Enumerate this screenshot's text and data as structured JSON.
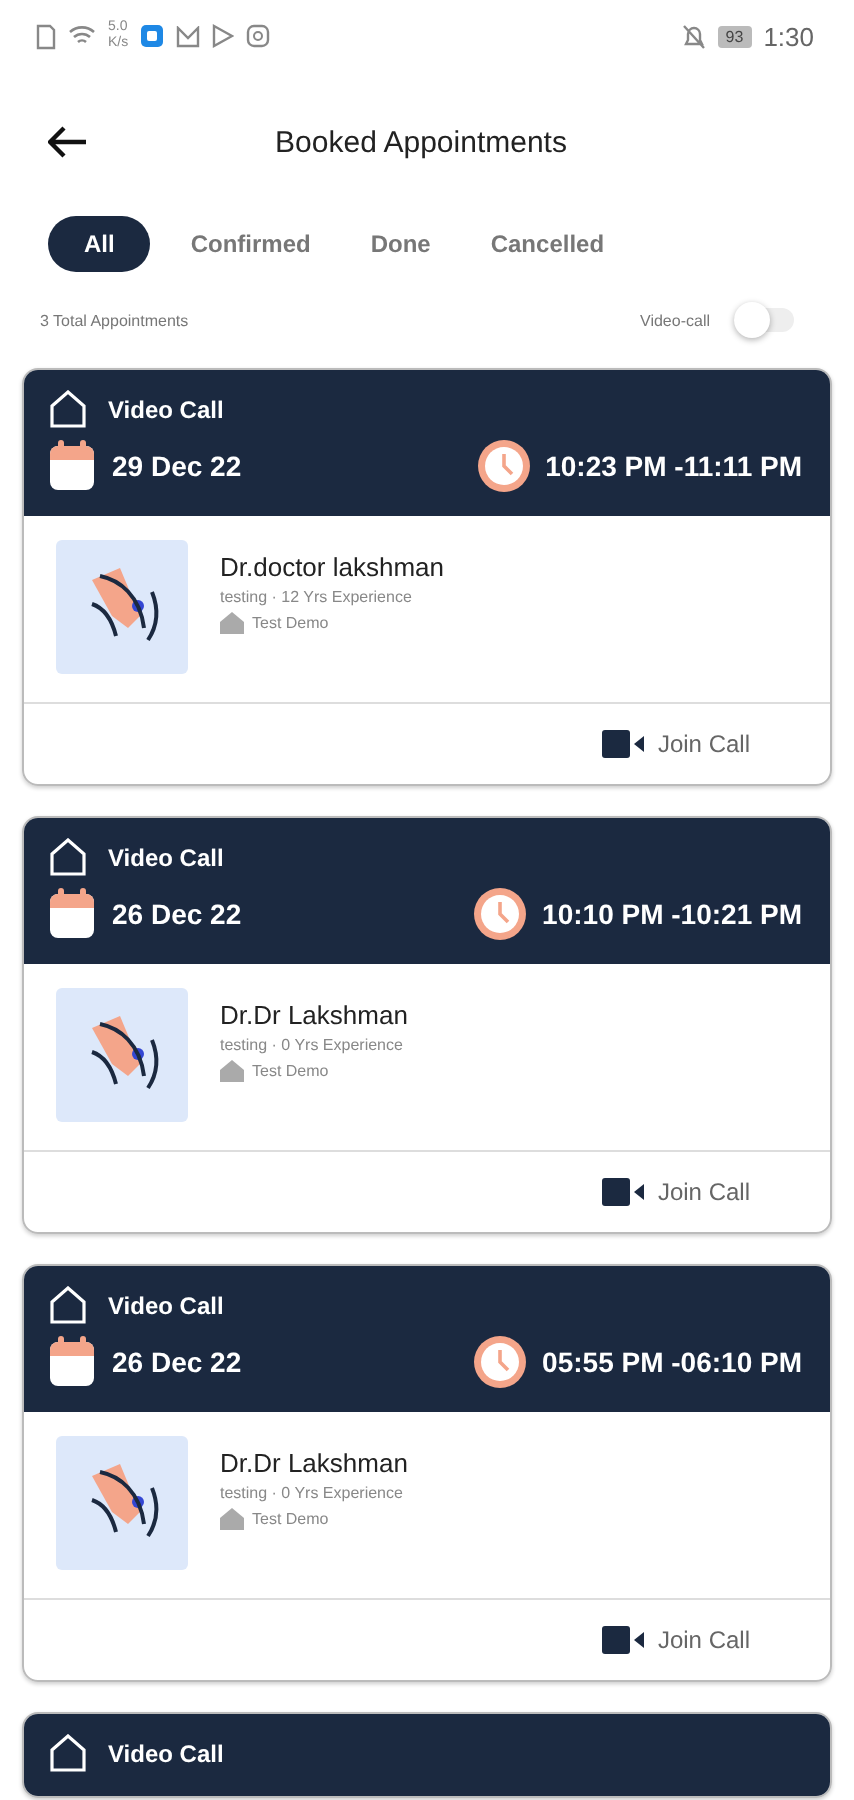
{
  "status_bar": {
    "speed": "5.0",
    "speed_unit": "K/s",
    "battery": "93",
    "time": "1:30"
  },
  "header": {
    "title": "Booked Appointments"
  },
  "tabs": [
    {
      "label": "All",
      "selected": true
    },
    {
      "label": "Confirmed",
      "selected": false
    },
    {
      "label": "Done",
      "selected": false
    },
    {
      "label": "Cancelled",
      "selected": false
    }
  ],
  "summary": {
    "total": "3 Total Appointments",
    "filter_label": "Video-call",
    "filter_on": false
  },
  "appointments": [
    {
      "type": "Video Call",
      "date": "29 Dec 22",
      "time": "10:23 PM -11:11 PM",
      "doctor": "Dr.doctor lakshman",
      "details": "testing · 12 Yrs Experience",
      "clinic": "Test Demo",
      "action": "Join Call"
    },
    {
      "type": "Video Call",
      "date": "26 Dec 22",
      "time": "10:10 PM -10:21 PM",
      "doctor": "Dr.Dr Lakshman",
      "details": "testing · 0 Yrs Experience",
      "clinic": "Test Demo",
      "action": "Join Call"
    },
    {
      "type": "Video Call",
      "date": "26 Dec 22",
      "time": "05:55 PM -06:10 PM",
      "doctor": "Dr.Dr Lakshman",
      "details": "testing · 0 Yrs Experience",
      "clinic": "Test Demo",
      "action": "Join Call"
    },
    {
      "type": "Video Call"
    }
  ]
}
